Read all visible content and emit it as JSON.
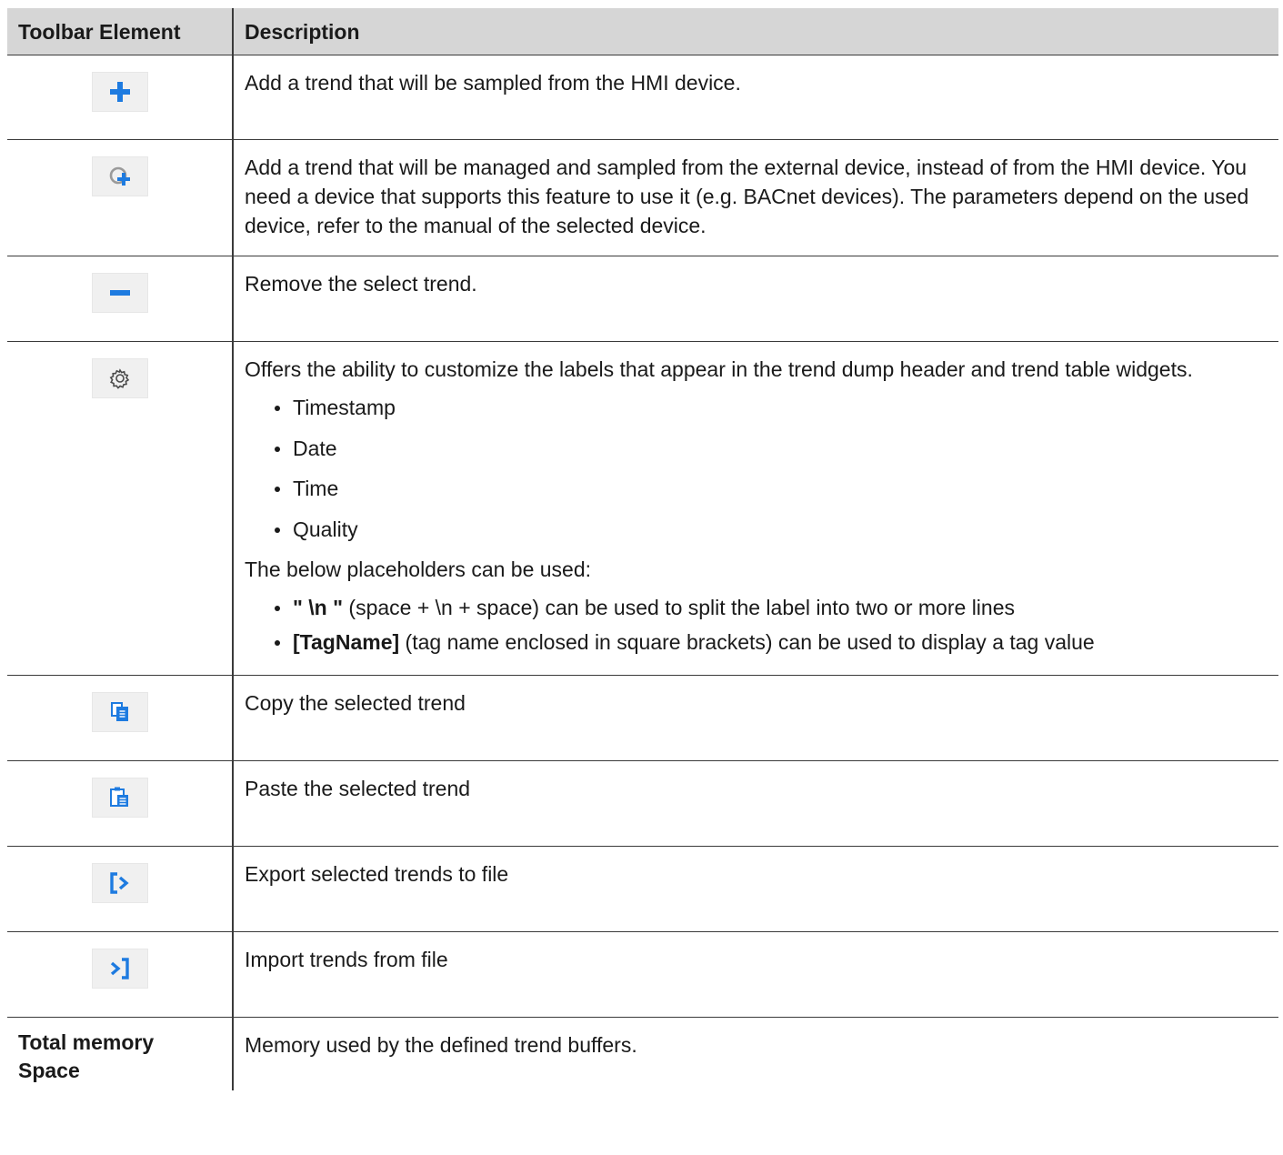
{
  "table": {
    "headers": [
      "Toolbar Element",
      "Description"
    ],
    "rows": [
      {
        "icon": "add-plus-icon",
        "description": "Add a trend that will be sampled from the HMI device."
      },
      {
        "icon": "add-external-trend-icon",
        "description": "Add a trend that will be managed and sampled from the external device, instead of from the HMI device. You need a device that supports this feature to use it (e.g. BACnet devices). The parameters depend on the used device, refer to the manual of the selected device."
      },
      {
        "icon": "remove-minus-icon",
        "description": "Remove the select trend."
      },
      {
        "icon": "gear-icon",
        "description": "Offers the ability to customize the labels that appear in the trend dump header and trend table widgets.",
        "label_items": [
          "Timestamp",
          "Date",
          "Time",
          "Quality"
        ],
        "placeholders_intro": "The below placeholders can be used:",
        "placeholders": [
          {
            "code": "\" \\n \"",
            "text": " (space + \\n + space) can be used to split the label into two or more lines"
          },
          {
            "code": "[TagName]",
            "text": " (tag name enclosed in square brackets) can be used to display a tag value"
          }
        ]
      },
      {
        "icon": "copy-icon",
        "description": "Copy the selected trend"
      },
      {
        "icon": "paste-icon",
        "description": "Paste the selected trend"
      },
      {
        "icon": "export-icon",
        "description": "Export selected trends to file"
      },
      {
        "icon": "import-icon",
        "description": "Import trends from file"
      },
      {
        "label": "Total memory Space",
        "description": "Memory used by the defined trend buffers."
      }
    ]
  },
  "colors": {
    "header_bg": "#d6d6d6",
    "icon_blue": "#1e7be0",
    "icon_grey": "#9a9a9a",
    "border": "#3a3a3a"
  }
}
